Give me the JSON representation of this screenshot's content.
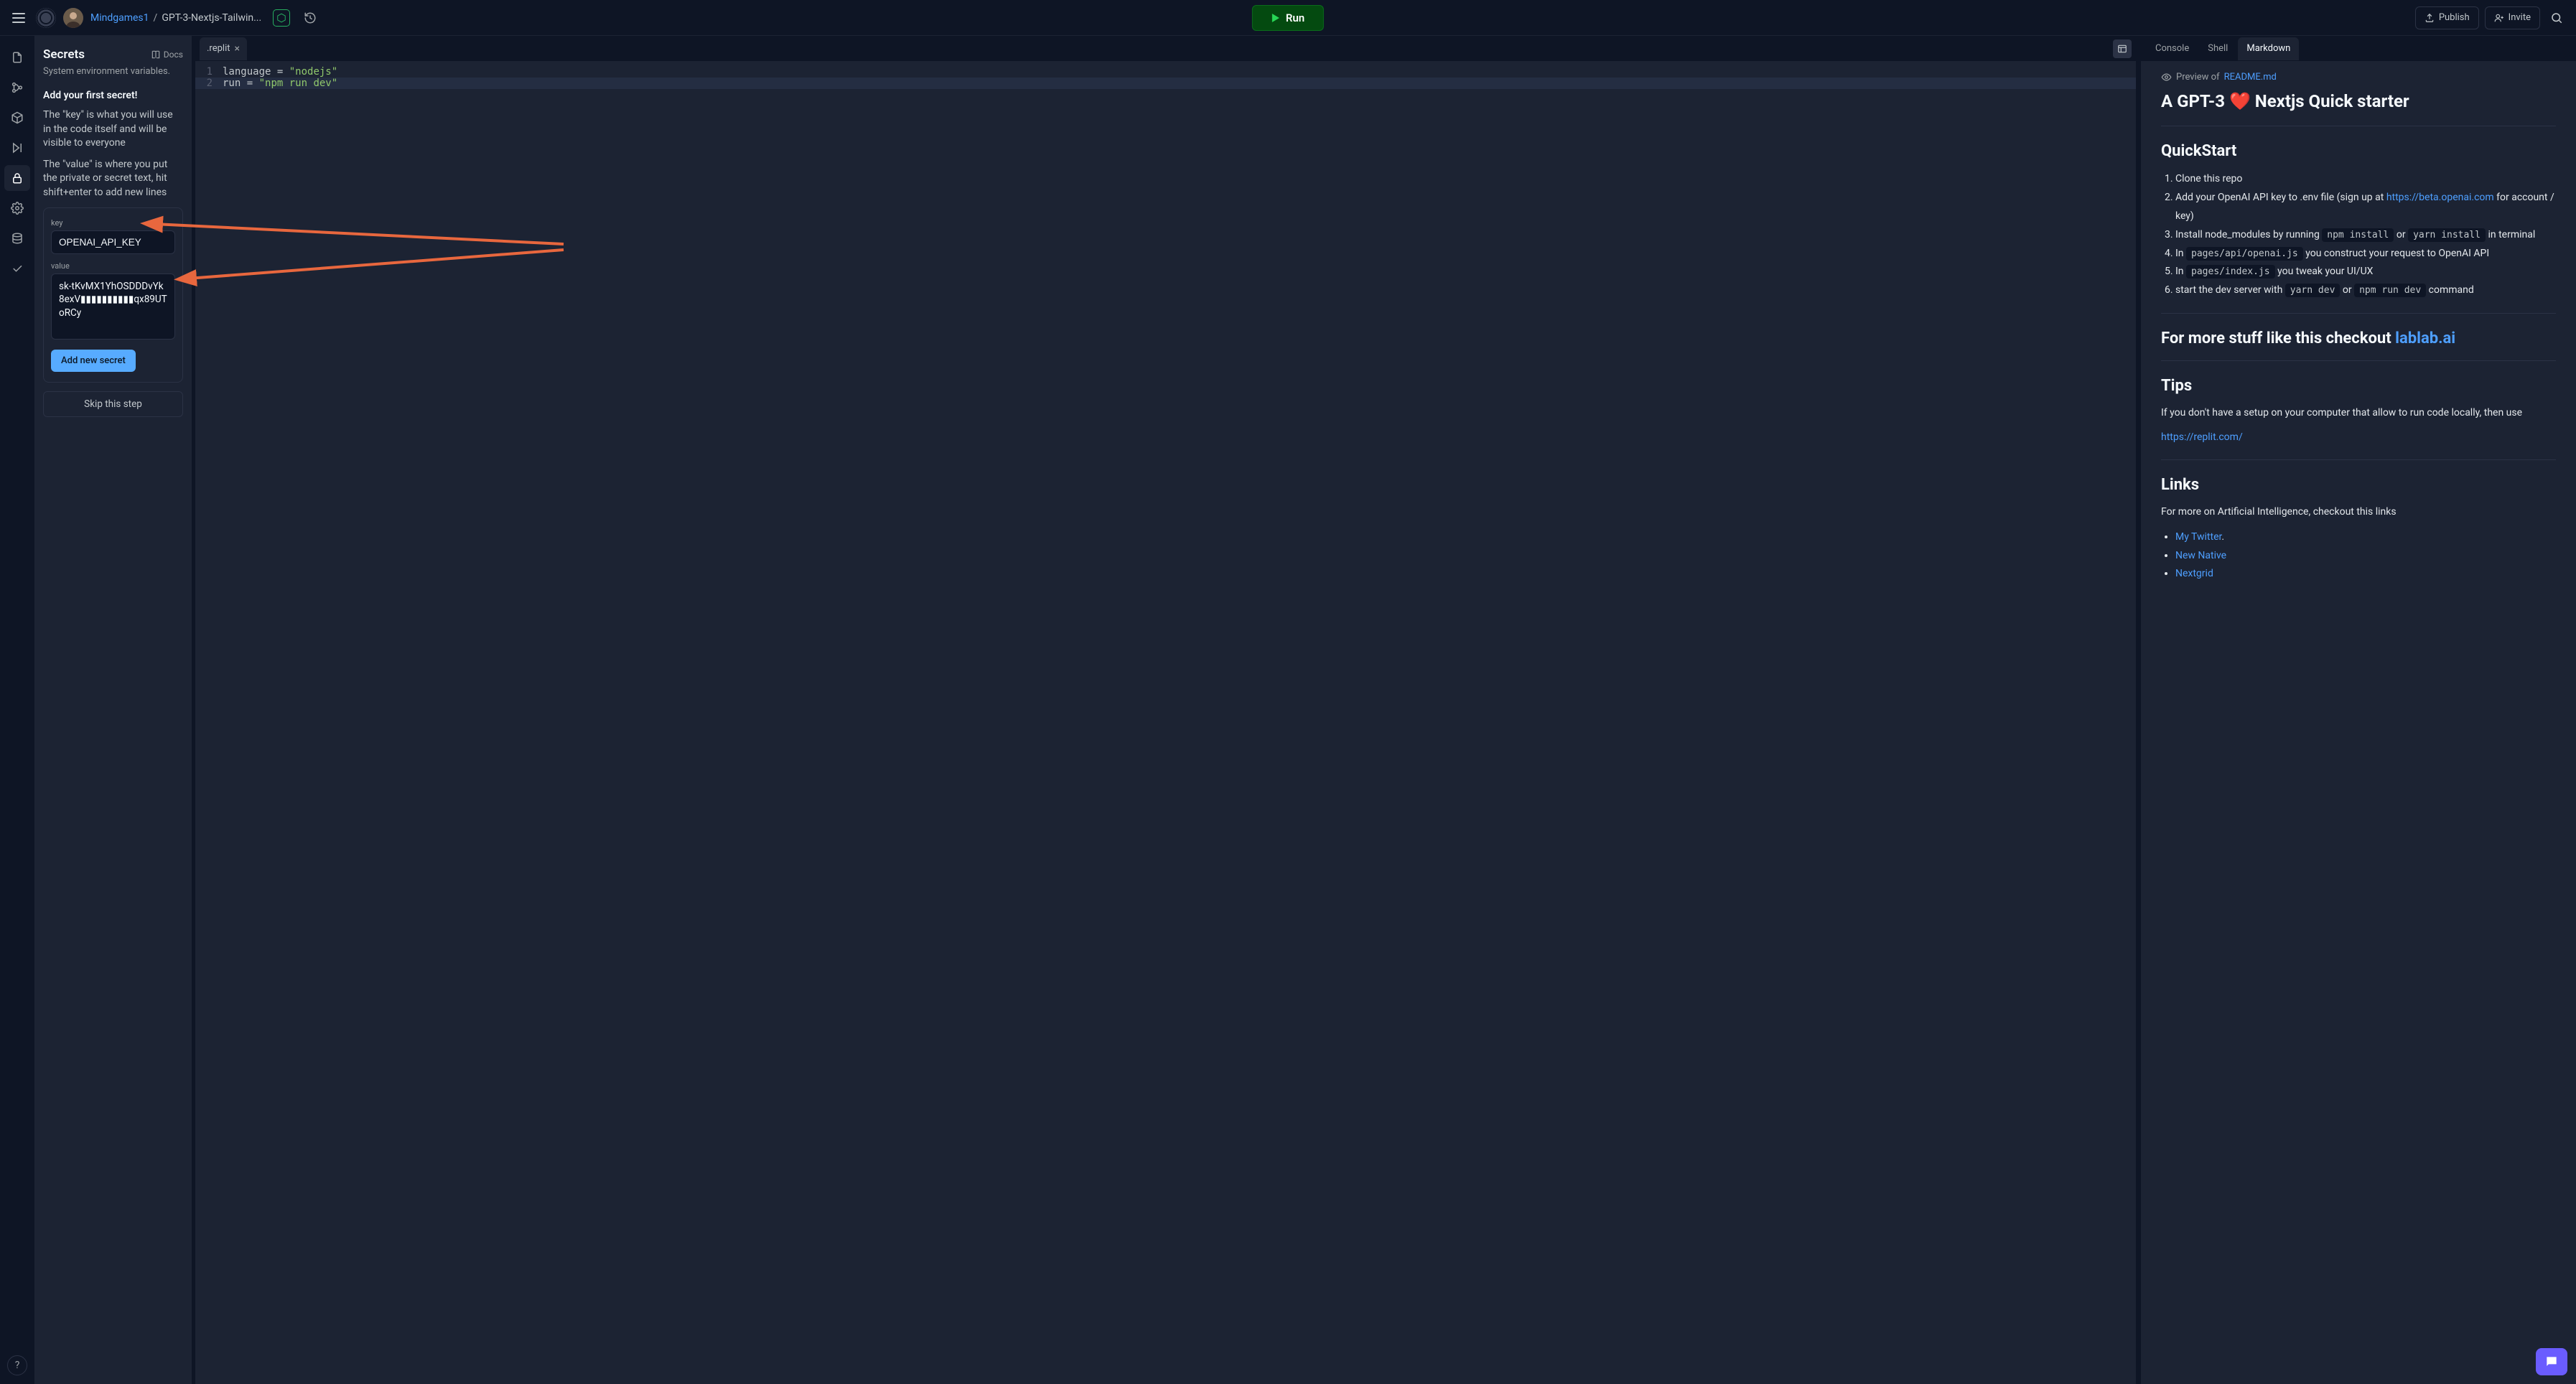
{
  "header": {
    "user": "Mindgames1",
    "project": "GPT-3-Nextjs-Tailwin...",
    "run_label": "Run",
    "publish_label": "Publish",
    "invite_label": "Invite"
  },
  "secrets": {
    "title": "Secrets",
    "docs_label": "Docs",
    "subtitle": "System environment variables.",
    "heading": "Add your first secret!",
    "para1": "The \"key\" is what you will use in the code itself and will be visible to everyone",
    "para2": "The \"value\" is where you put the private or secret text, hit shift+enter to add new lines",
    "key_label": "key",
    "key_value": "OPENAI_API_KEY",
    "value_label": "value",
    "value_content": "sk-tKvMX1YhOSDDDvYk8exV▮▮▮▮▮▮▮▮▮▮qx89UToRCy",
    "add_btn": "Add new secret",
    "skip_btn": "Skip this step"
  },
  "editor": {
    "tab_filename": ".replit",
    "lines": [
      {
        "id": "language",
        "val": "\"nodejs\""
      },
      {
        "id": "run",
        "val": "\"npm run dev\""
      }
    ]
  },
  "preview": {
    "tabs": {
      "console": "Console",
      "shell": "Shell",
      "markdown": "Markdown"
    },
    "meta_prefix": "Preview of ",
    "meta_file": "README.md",
    "h1": "A GPT-3 ❤️ Nextjs Quick starter",
    "quickstart_title": "QuickStart",
    "step1": "Clone this repo",
    "step2a": "Add your OpenAI API key to .env file (sign up at ",
    "step2_link": "https://beta.openai.com",
    "step2b": " for account / key)",
    "step3a": "Install node_modules by running ",
    "step3_code1": "npm install",
    "step3_mid": " or ",
    "step3_code2": "yarn install",
    "step3b": " in terminal",
    "step4a": "In ",
    "step4_code": "pages/api/openai.js",
    "step4b": " you construct your request to OpenAI API",
    "step5a": "In ",
    "step5_code": "pages/index.js",
    "step5b": " you tweak your UI/UX",
    "step6a": "start the dev server with ",
    "step6_code1": "yarn dev",
    "step6_mid": " or ",
    "step6_code2": "npm run dev",
    "step6b": " command",
    "more_h2a": "For more stuff like this checkout ",
    "more_link": "lablab.ai",
    "tips_title": "Tips",
    "tips_text": "If you don't have a setup on your computer that allow to run code locally, then use",
    "tips_link": "https://replit.com/",
    "links_title": "Links",
    "links_intro": "For more on Artificial Intelligence, checkout this links",
    "link1": "My Twitter",
    "link2": "New Native",
    "link3": "Nextgrid"
  }
}
